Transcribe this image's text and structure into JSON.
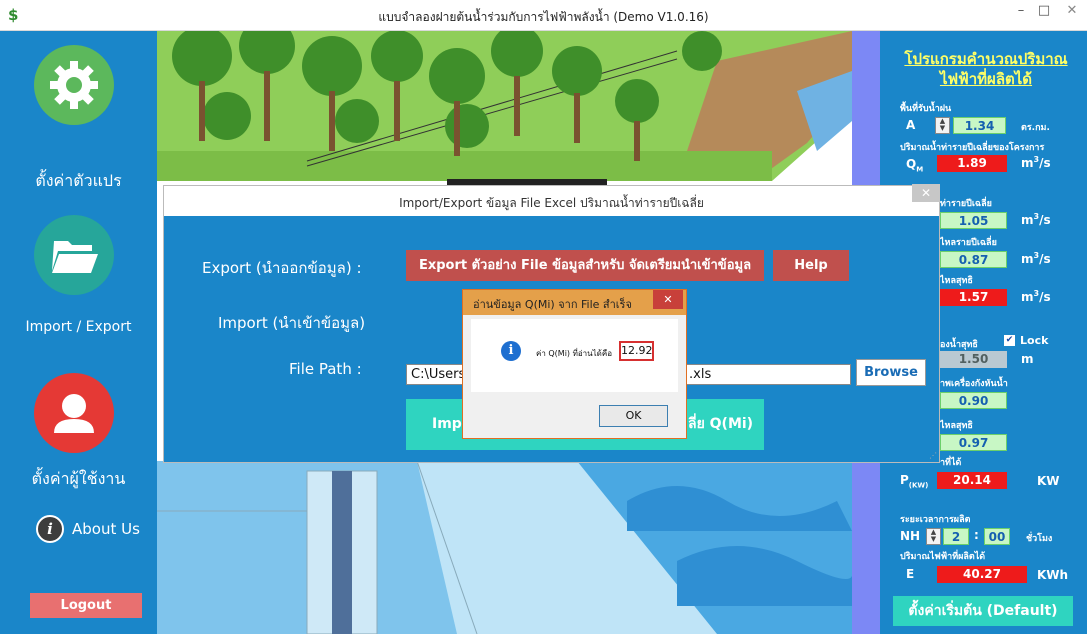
{
  "window": {
    "title": "แบบจำลองฝายต้นน้ำร่วมกับการไฟฟ้าพลังน้ำ (Demo V1.0.16)",
    "icon": "app-logo-icon",
    "min_label": "–",
    "max_label": "□",
    "close_label": "✕"
  },
  "sidebar": {
    "items": [
      {
        "label": "ตั้งค่าตัวแปร",
        "icon": "gear-icon",
        "color": "#5cb85c"
      },
      {
        "label": "Import / Export",
        "icon": "folder-icon",
        "color": "#26a69a"
      },
      {
        "label": "ตั้งค่าผู้ใช้งาน",
        "icon": "user-icon",
        "color": "#e53935"
      }
    ],
    "about_icon_text": "i",
    "about_label": "About Us",
    "logout_label": "Logout"
  },
  "right_panel": {
    "title": "โปรแกรมคำนวณปริมาณไฟฟ้าที่ผลิตได้",
    "area_label": "พื้นที่รับน้ำฝน",
    "a_symbol": "A",
    "a_value": "1.34",
    "a_unit": "ตร.กม.",
    "flow_label": "ปริมาณน้ำท่ารายปีเฉลี่ยของโครงการ",
    "qm_symbol": "Q",
    "qm_sub": "M",
    "qm_value": "1.89",
    "qm_unit_base": "m",
    "qm_unit_sup": "3",
    "qm_unit_tail": "/s",
    "row3_label": "ท่ารายปีเฉลี่ย",
    "row3_value": "1.05",
    "row4_label": "ไหลรายปีเฉลี่ย",
    "row4_value": "0.87",
    "row5_label": "ไหลสุทธิ",
    "row5_value": "1.57",
    "head_label": "องน้ำสุทธิ",
    "lock_label": "Lock",
    "lock_check": "✔",
    "head_value": "1.50",
    "head_unit": "m",
    "eff_label": "าพเครื่องกังหันน้ำ",
    "eff_value": "0.90",
    "row8_label": "ไหลสุทธิ",
    "row8_value": "0.97",
    "power_head_label": "าที่ได้",
    "p_symbol": "P",
    "p_sub": "(KW)",
    "p_value": "20.14",
    "p_unit": "KW",
    "time_label": "ระยะเวลาการผลิต",
    "nh_symbol": "NH",
    "nh_hours": "2",
    "nh_colon": ":",
    "nh_minutes": "00",
    "nh_unit": "ชั่วโมง",
    "energy_label": "ปริมาณไฟฟ้าที่ผลิตได้",
    "e_symbol": "E",
    "e_value": "40.27",
    "e_unit": "KWh",
    "default_button": "ตั้งค่าเริ่มต้น (Default)"
  },
  "dialog": {
    "title": "Import/Export ข้อมูล File Excel ปริมาณน้ำท่ารายปีเฉลี่ย",
    "close_label": "✕",
    "export_label": "Export (นำออกข้อมูล) :",
    "export_button": "Export ตัวอย่าง File ข้อมูลสำหรับ จัดเตรียมนำเข้าข้อมูล",
    "help_button": "Help",
    "import_label": "Import (นำเข้าข้อมูล)",
    "filepath_label": "File Path :",
    "filepath_left": "C:\\Users",
    "filepath_right": ".xls",
    "browse_button": "Browse",
    "import_button_left": "Imp",
    "import_button_right": "ลี่ย Q(Mi)"
  },
  "messagebox": {
    "title": "อ่านข้อมูล Q(Mi) จาก File สำเร็จ",
    "close_label": "✕",
    "text": "ค่า Q(Mi) ที่อ่านได้คือ",
    "value": "12.92",
    "ok_button": "OK",
    "icon": "info-icon"
  }
}
